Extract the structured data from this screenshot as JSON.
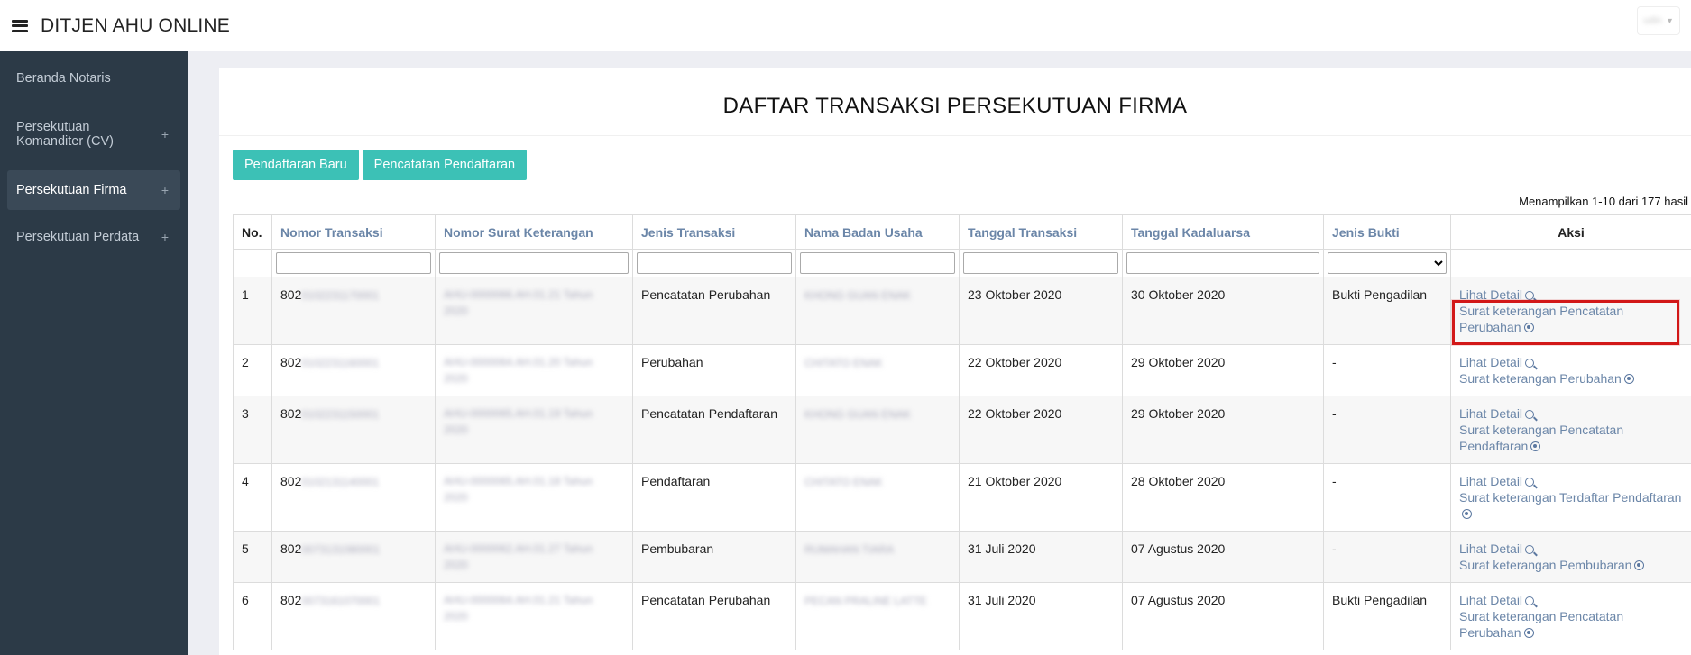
{
  "header": {
    "app_title": "DITJEN AHU ONLINE",
    "user_label": "udin"
  },
  "sidebar": {
    "items": [
      {
        "label": "Beranda Notaris"
      },
      {
        "label": "Persekutuan Komanditer (CV)",
        "plus": "+"
      },
      {
        "label": "Persekutuan Firma",
        "plus": "+"
      },
      {
        "label": "Persekutuan Perdata",
        "plus": "+"
      }
    ]
  },
  "main": {
    "page_title": "DAFTAR TRANSAKSI PERSEKUTUAN FIRMA",
    "buttons": {
      "pendaftaran_baru": "Pendaftaran Baru",
      "pencatatan_pendaftaran": "Pencatatan Pendaftaran"
    },
    "result_count": "Menampilkan 1-10 dari 177 hasil"
  },
  "table": {
    "headers": [
      "No.",
      "Nomor Transaksi",
      "Nomor Surat Keterangan",
      "Jenis Transaksi",
      "Nama Badan Usaha",
      "Tanggal Transaksi",
      "Tanggal Kadaluarsa",
      "Jenis Bukti",
      "Aksi"
    ],
    "detail_label": "Lihat Detail",
    "rows": [
      {
        "no": "1",
        "nomor_transaksi_prefix": "802",
        "nomor_transaksi_masked": "0102231170001",
        "nomor_surat_masked_1": "AHU-0000066.AH.01.21 Tahun",
        "nomor_surat_masked_2": "2020",
        "jenis_transaksi": "Pencatatan Perubahan",
        "nama_badan_masked": "KHONG GUAN ENAK",
        "tanggal_transaksi": "23 Oktober 2020",
        "tanggal_kadaluarsa": "30 Oktober 2020",
        "jenis_bukti": "Bukti Pengadilan",
        "surat_link": "Surat keterangan Pencatatan Perubahan"
      },
      {
        "no": "2",
        "nomor_transaksi_prefix": "802",
        "nomor_transaksi_masked": "0102231160001",
        "nomor_surat_masked_1": "AHU-0000064.AH.01.20 Tahun",
        "nomor_surat_masked_2": "2020",
        "jenis_transaksi": "Perubahan",
        "nama_badan_masked": "CHITATO ENAK",
        "tanggal_transaksi": "22 Oktober 2020",
        "tanggal_kadaluarsa": "29 Oktober 2020",
        "jenis_bukti": "-",
        "surat_link": "Surat keterangan Perubahan"
      },
      {
        "no": "3",
        "nomor_transaksi_prefix": "802",
        "nomor_transaksi_masked": "0102231150001",
        "nomor_surat_masked_1": "AHU-0000065.AH.01.19 Tahun",
        "nomor_surat_masked_2": "2020",
        "jenis_transaksi": "Pencatatan Pendaftaran",
        "nama_badan_masked": "KHONG GUAN ENAK",
        "tanggal_transaksi": "22 Oktober 2020",
        "tanggal_kadaluarsa": "29 Oktober 2020",
        "jenis_bukti": "-",
        "surat_link": "Surat keterangan Pencatatan Pendaftaran"
      },
      {
        "no": "4",
        "nomor_transaksi_prefix": "802",
        "nomor_transaksi_masked": "0102131140001",
        "nomor_surat_masked_1": "AHU-0000065.AH.01.18 Tahun",
        "nomor_surat_masked_2": "2020",
        "jenis_transaksi": "Pendaftaran",
        "nama_badan_masked": "CHITATO ENAK",
        "tanggal_transaksi": "21 Oktober 2020",
        "tanggal_kadaluarsa": "28 Oktober 2020",
        "jenis_bukti": "-",
        "surat_link": "Surat keterangan Terdaftar Pendaftaran"
      },
      {
        "no": "5",
        "nomor_transaksi_prefix": "802",
        "nomor_transaksi_masked": "0073131080001",
        "nomor_surat_masked_1": "AHU-0000062.AH.01.27 Tahun",
        "nomor_surat_masked_2": "2020",
        "jenis_transaksi": "Pembubaran",
        "nama_badan_masked": "RUMAHAN TIARA",
        "tanggal_transaksi": "31 Juli 2020",
        "tanggal_kadaluarsa": "07 Agustus 2020",
        "jenis_bukti": "-",
        "surat_link": "Surat keterangan Pembubaran"
      },
      {
        "no": "6",
        "nomor_transaksi_prefix": "802",
        "nomor_transaksi_masked": "0073161070001",
        "nomor_surat_masked_1": "AHU-0000064.AH.01.21 Tahun",
        "nomor_surat_masked_2": "2020",
        "jenis_transaksi": "Pencatatan Perubahan",
        "nama_badan_masked": "PECAN PRALINE LATTE",
        "tanggal_transaksi": "31 Juli 2020",
        "tanggal_kadaluarsa": "07 Agustus 2020",
        "jenis_bukti": "Bukti Pengadilan",
        "surat_link": "Surat keterangan Pencatatan Perubahan"
      }
    ]
  },
  "colors": {
    "sidebar_bg": "#2c3a47",
    "accent_button": "#3cc1b6",
    "link": "#6b86a8",
    "highlight": "#d21818"
  }
}
